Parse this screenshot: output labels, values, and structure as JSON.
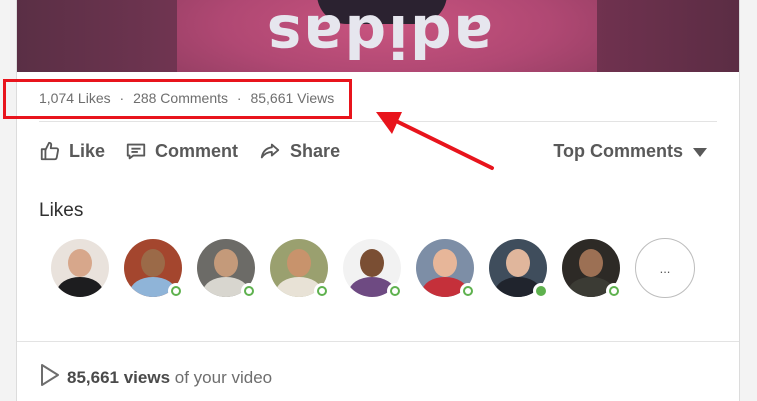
{
  "stats": {
    "likes": "1,074 Likes",
    "comments": "288 Comments",
    "views": "85,661 Views",
    "separator": "·"
  },
  "actions": {
    "like_label": "Like",
    "comment_label": "Comment",
    "share_label": "Share",
    "sort_label": "Top Comments"
  },
  "likes_section": {
    "title": "Likes",
    "avatars": [
      {
        "online": false,
        "bg": "#e9e2dc",
        "face": "#d7a78b",
        "body": "#1d1d1f"
      },
      {
        "online": true,
        "bg": "#a4462e",
        "face": "#9b6a48",
        "body": "#8fb4d8"
      },
      {
        "online": true,
        "bg": "#6c6b67",
        "face": "#c49a7a",
        "body": "#d8d6cf"
      },
      {
        "online": true,
        "bg": "#9aa06f",
        "face": "#c8936c",
        "body": "#e8e2d6"
      },
      {
        "online": true,
        "bg": "#f2f2f2",
        "face": "#7a4e33",
        "body": "#6e4a82"
      },
      {
        "online": true,
        "bg": "#7d8ea6",
        "face": "#e7b699",
        "body": "#c5303a"
      },
      {
        "online": true,
        "bg": "#3f4d5c",
        "face": "#e0b69c",
        "body": "#20242d"
      },
      {
        "online": true,
        "bg": "#2d2a26",
        "face": "#9c7054",
        "body": "#3b3b34"
      }
    ],
    "more_label": "..."
  },
  "video_stats": {
    "views_count": "85,661 views",
    "suffix": "of your video"
  },
  "colors": {
    "highlight": "#e8141c",
    "online": "#5eb14e"
  }
}
